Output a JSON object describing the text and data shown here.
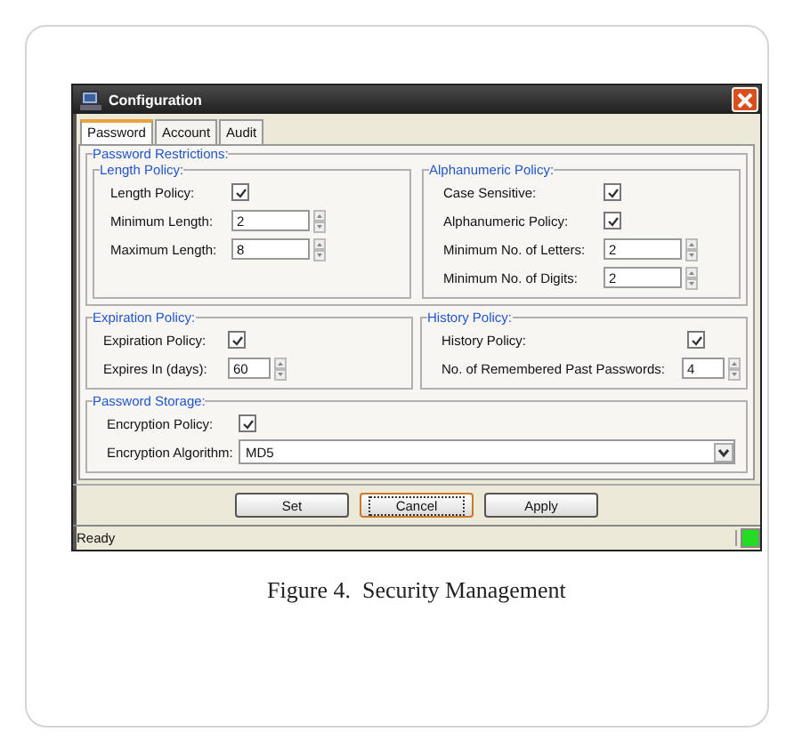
{
  "window": {
    "title": "Configuration"
  },
  "tabs": [
    {
      "label": "Password",
      "selected": true
    },
    {
      "label": "Account",
      "selected": false
    },
    {
      "label": "Audit",
      "selected": false
    }
  ],
  "password_restrictions": {
    "title": "Password Restrictions:",
    "groups": [
      {
        "title": "Length Policy:",
        "fields": [
          {
            "kind": "checkbox",
            "label": "Length Policy:",
            "checked": true
          },
          {
            "kind": "spinner",
            "label": "Minimum Length:",
            "value": "2"
          },
          {
            "kind": "spinner",
            "label": "Maximum Length:",
            "value": "8"
          }
        ]
      },
      {
        "title": "Alphanumeric Policy:",
        "fields": [
          {
            "kind": "checkbox",
            "label": "Case Sensitive:",
            "checked": true
          },
          {
            "kind": "checkbox",
            "label": "Alphanumeric Policy:",
            "checked": true
          },
          {
            "kind": "spinner",
            "label": "Minimum No. of Letters:",
            "value": "2"
          },
          {
            "kind": "spinner",
            "label": "Minimum No. of Digits:",
            "value": "2"
          }
        ]
      }
    ]
  },
  "policy_groups": [
    {
      "title": "Expiration Policy:",
      "fields": [
        {
          "kind": "checkbox",
          "label": "Expiration Policy:",
          "checked": true
        },
        {
          "kind": "spinner",
          "label": "Expires In (days):",
          "value": "60"
        }
      ]
    },
    {
      "title": "History Policy:",
      "fields": [
        {
          "kind": "checkbox",
          "label": "History Policy:",
          "checked": true
        },
        {
          "kind": "spinner",
          "label": "No. of Remembered Past Passwords:",
          "value": "4"
        }
      ]
    }
  ],
  "password_storage": {
    "title": "Password Storage:",
    "fields": [
      {
        "kind": "checkbox",
        "label": "Encryption Policy:",
        "checked": true
      },
      {
        "kind": "dropdown",
        "label": "Encryption Algorithm:",
        "value": "MD5"
      }
    ]
  },
  "buttons": [
    {
      "label": "Set",
      "focused": false
    },
    {
      "label": "Cancel",
      "focused": true
    },
    {
      "label": "Apply",
      "focused": false
    }
  ],
  "status_bar": {
    "text": "Ready"
  },
  "caption": "Figure 4.  Security Management"
}
